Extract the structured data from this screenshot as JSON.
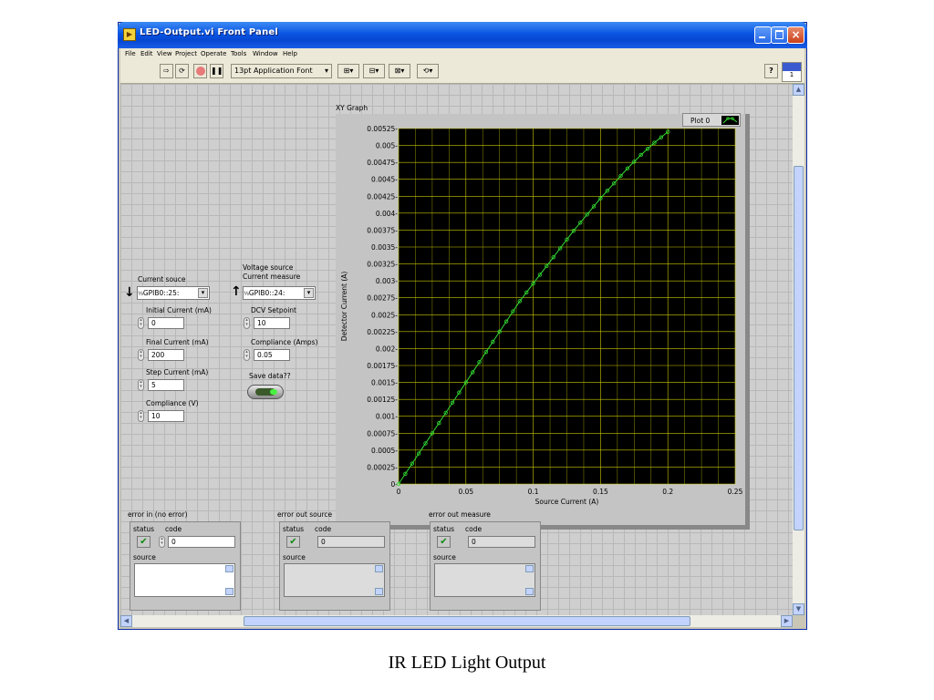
{
  "window": {
    "title": "LED-Output.vi Front Panel"
  },
  "menu": [
    "File",
    "Edit",
    "View",
    "Project",
    "Operate",
    "Tools",
    "Window",
    "Help"
  ],
  "toolbar": {
    "font": "13pt Application Font",
    "instance_label": "1"
  },
  "source": {
    "resource_label": "Current souce",
    "resource_value": "GPIB0::25:",
    "initial_label": "Initial Current (mA)",
    "initial_value": "0",
    "final_label": "Final Current (mA)",
    "final_value": "200",
    "step_label": "Step Current (mA)",
    "step_value": "5",
    "compliance_label": "Compliance (V)",
    "compliance_value": "10"
  },
  "measure": {
    "resource_label": "Voltage source\nCurrent measure",
    "resource_value": "GPIB0::24:",
    "dcv_label": "DCV Setpoint",
    "dcv_value": "10",
    "compliance_label": "Compliance (Amps)",
    "compliance_value": "0.05",
    "save_label": "Save data??"
  },
  "graph": {
    "label": "XY Graph",
    "legend": "Plot 0"
  },
  "chart_data": {
    "type": "scatter",
    "xlabel": "Source Current (A)",
    "ylabel": "Detector Current (A)",
    "xlim": [
      0,
      0.25
    ],
    "ylim": [
      0,
      0.00525
    ],
    "x_ticks": [
      "0",
      "0.05",
      "0.1",
      "0.15",
      "0.2",
      "0.25"
    ],
    "y_ticks": [
      "0-",
      "0.00025-",
      "0.0005-",
      "0.00075-",
      "0.001-",
      "0.00125-",
      "0.0015-",
      "0.00175-",
      "0.002-",
      "0.00225-",
      "0.0025-",
      "0.00275-",
      "0.003-",
      "0.00325-",
      "0.0035-",
      "0.00375-",
      "0.004-",
      "0.00425-",
      "0.0045-",
      "0.00475-",
      "0.005-",
      "0.00525-"
    ],
    "grid": true,
    "series": [
      {
        "name": "Plot 0",
        "color": "#33dd33",
        "x": [
          0,
          0.005,
          0.01,
          0.015,
          0.02,
          0.025,
          0.03,
          0.035,
          0.04,
          0.045,
          0.05,
          0.055,
          0.06,
          0.065,
          0.07,
          0.075,
          0.08,
          0.085,
          0.09,
          0.095,
          0.1,
          0.105,
          0.11,
          0.115,
          0.12,
          0.125,
          0.13,
          0.135,
          0.14,
          0.145,
          0.15,
          0.155,
          0.16,
          0.165,
          0.17,
          0.175,
          0.18,
          0.185,
          0.19,
          0.195,
          0.2
        ],
        "y": [
          0,
          0.00015,
          0.0003,
          0.00045,
          0.0006,
          0.00075,
          0.0009,
          0.00105,
          0.0012,
          0.00135,
          0.0015,
          0.00165,
          0.0018,
          0.00195,
          0.0021,
          0.00225,
          0.0024,
          0.00255,
          0.0027,
          0.00283,
          0.00296,
          0.00309,
          0.00322,
          0.00335,
          0.00348,
          0.00361,
          0.00374,
          0.00386,
          0.00398,
          0.0041,
          0.00422,
          0.00433,
          0.00444,
          0.00455,
          0.00466,
          0.00476,
          0.00486,
          0.00495,
          0.00504,
          0.00512,
          0.0052
        ]
      }
    ]
  },
  "errors": [
    {
      "title": "error in (no error)",
      "status": "status",
      "code_label": "code",
      "code": "0",
      "source": "source"
    },
    {
      "title": "error out source",
      "status": "status",
      "code_label": "code",
      "code": "0",
      "source": "source"
    },
    {
      "title": "error out measure",
      "status": "status",
      "code_label": "code",
      "code": "0",
      "source": "source"
    }
  ],
  "caption": "IR LED Light Output"
}
